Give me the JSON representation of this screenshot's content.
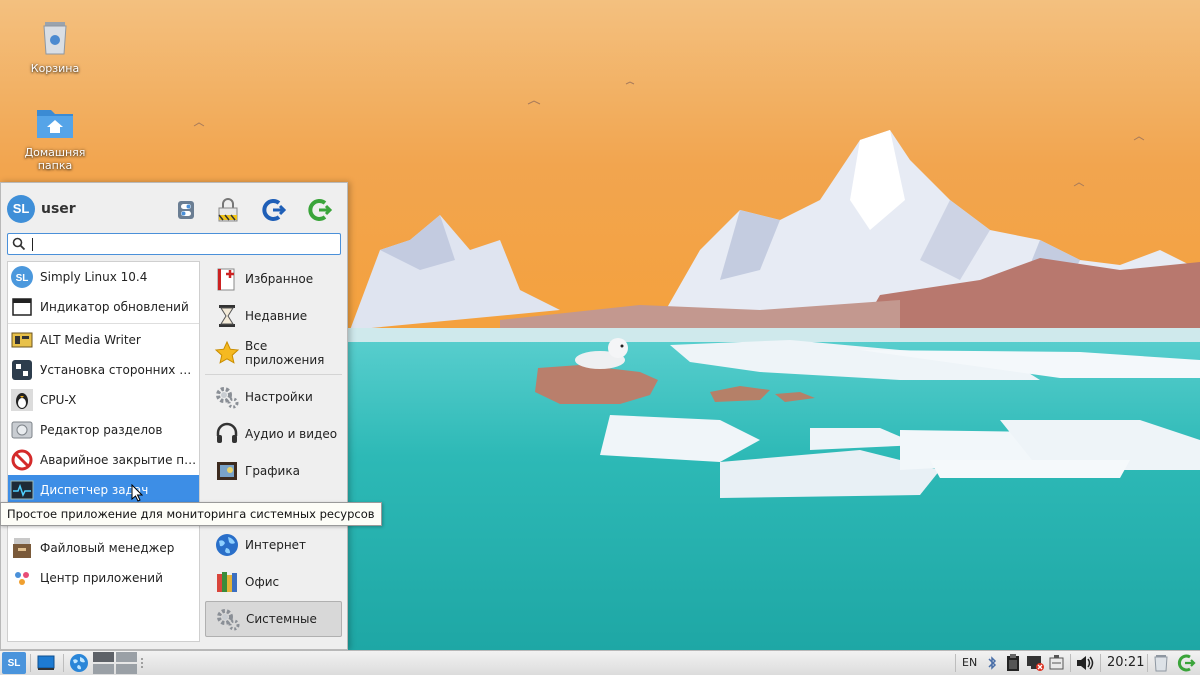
{
  "desktop": {
    "icons": [
      {
        "label": "Корзина"
      },
      {
        "label": "Домашняя папка"
      }
    ]
  },
  "menu": {
    "user": {
      "avatar": "SL",
      "name": "user"
    },
    "header_buttons": [
      "settings-toggle-icon",
      "lock-screen-icon",
      "logout-icon",
      "shutdown-icon"
    ],
    "search": {
      "value": "",
      "placeholder": ""
    },
    "apps": [
      {
        "label": "Simply Linux 10.4",
        "icon": "simply-linux-icon"
      },
      {
        "label": "Индикатор обновлений",
        "icon": "window-icon"
      },
      {
        "label": "ALT Media Writer",
        "icon": "media-writer-icon"
      },
      {
        "label": "Установка сторонних при...",
        "icon": "third-party-install-icon"
      },
      {
        "label": "CPU-X",
        "icon": "tux-icon"
      },
      {
        "label": "Редактор разделов",
        "icon": "disk-icon"
      },
      {
        "label": "Аварийное закрытие прог...",
        "icon": "kill-icon"
      },
      {
        "label": "Диспетчер задач",
        "icon": "task-manager-icon"
      },
      {
        "label": "Файловый менеджер",
        "icon": "file-manager-icon"
      },
      {
        "label": "Центр приложений",
        "icon": "app-center-icon"
      }
    ],
    "categories": [
      {
        "label": "Избранное",
        "icon": "favorites-icon"
      },
      {
        "label": "Недавние",
        "icon": "recent-icon"
      },
      {
        "label": "Все приложения",
        "icon": "star-icon"
      },
      {
        "label": "Настройки",
        "icon": "settings-icon"
      },
      {
        "label": "Аудио и видео",
        "icon": "headphones-icon"
      },
      {
        "label": "Графика",
        "icon": "graphics-icon"
      },
      {
        "label": "Интернет",
        "icon": "globe-icon"
      },
      {
        "label": "Офис",
        "icon": "books-icon"
      },
      {
        "label": "Системные",
        "icon": "gear-icon"
      }
    ],
    "tooltip": "Простое приложение для мониторинга системных ресурсов"
  },
  "taskbar": {
    "start_label": "SL",
    "tray": {
      "language": "EN",
      "clock": "20:21"
    }
  },
  "colors": {
    "accent": "#3d8ee6",
    "sky_top": "#f0b066",
    "sea": "#2bb3b0"
  }
}
